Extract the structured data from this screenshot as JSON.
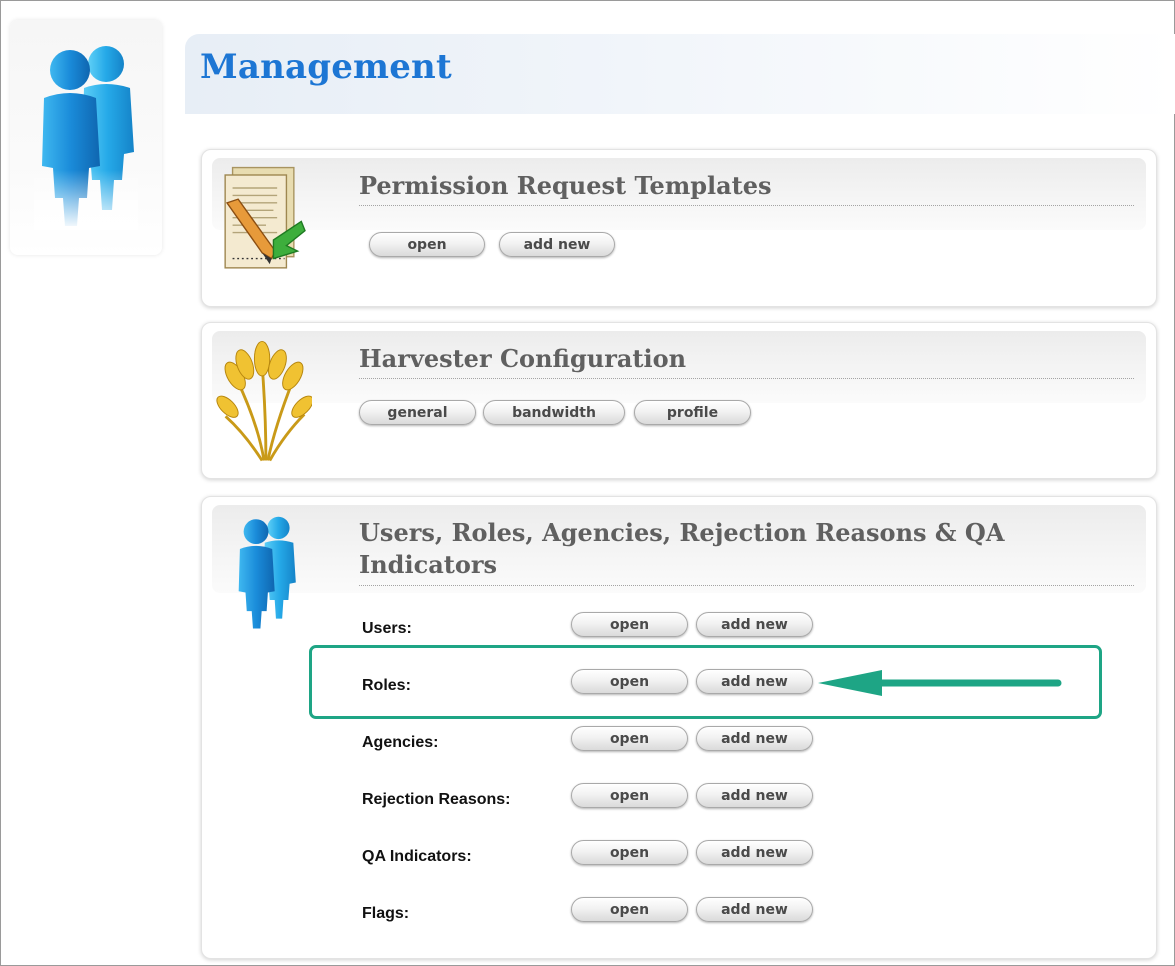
{
  "page": {
    "title": "Management"
  },
  "sections": {
    "permission": {
      "title": "Permission Request Templates",
      "buttons": [
        "open",
        "add new"
      ],
      "icon": "document-edit-icon"
    },
    "harvester": {
      "title": "Harvester Configuration",
      "buttons": [
        "general",
        "bandwidth",
        "profile"
      ],
      "icon": "wheat-icon"
    },
    "users": {
      "title_line1": "Users, Roles, Agencies, Rejection Reasons & QA",
      "title_line2": "Indicators",
      "icon": "users-icon",
      "rows": [
        {
          "label": "Users:",
          "open": "open",
          "add": "add new"
        },
        {
          "label": "Roles:",
          "open": "open",
          "add": "add new"
        },
        {
          "label": "Agencies:",
          "open": "open",
          "add": "add new"
        },
        {
          "label": "Rejection Reasons:",
          "open": "open",
          "add": "add new"
        },
        {
          "label": "QA Indicators:",
          "open": "open",
          "add": "add new"
        },
        {
          "label": "Flags:",
          "open": "open",
          "add": "add new"
        }
      ]
    }
  },
  "annotation": {
    "highlight_color": "#1ea585",
    "highlighted_row": "Roles:"
  },
  "colors": {
    "title_blue": "#1d76d4",
    "section_title_gray": "#606060"
  }
}
